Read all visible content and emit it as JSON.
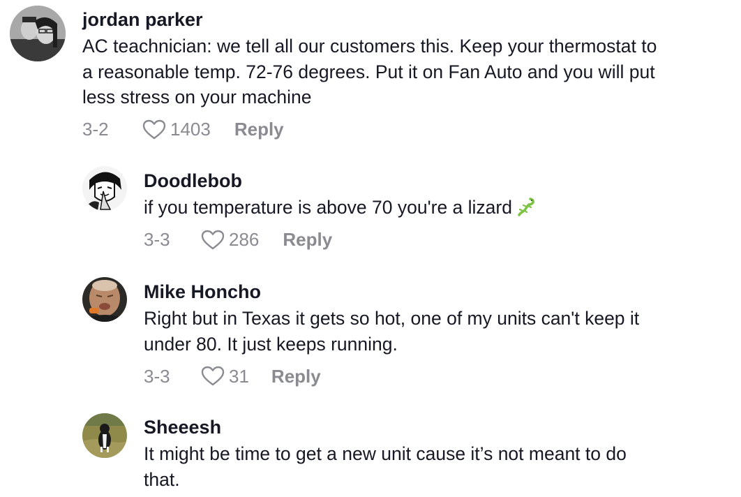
{
  "comments": [
    {
      "username": "jordan parker",
      "text_lines": [
        "AC teachnician: we tell all our customers this. Keep your thermostat to",
        "a reasonable temp. 72-76 degrees. Put it on Fan Auto and you will put",
        "less stress on your machine"
      ],
      "date": "3-2",
      "likes": "1403",
      "reply_label": "Reply"
    },
    {
      "username": "Doodlebob",
      "text_lines": [
        "if you temperature is above 70 you're a lizard"
      ],
      "emoji": "lizard-emoji",
      "date": "3-3",
      "likes": "286",
      "reply_label": "Reply"
    },
    {
      "username": "Mike Honcho",
      "text_lines": [
        "Right but in Texas it gets so hot, one of my units can't keep it",
        "under 80. It just keeps running."
      ],
      "date": "3-3",
      "likes": "31",
      "reply_label": "Reply"
    },
    {
      "username": "Sheeesh",
      "text_lines": [
        "It might be time to get a new unit cause it’s not meant to do",
        "that."
      ]
    }
  ],
  "colors": {
    "text": "#161823",
    "meta": "#8a8b91",
    "lizard": "#7cc243"
  },
  "icons": [
    "heart-outline-icon",
    "lizard-emoji"
  ]
}
